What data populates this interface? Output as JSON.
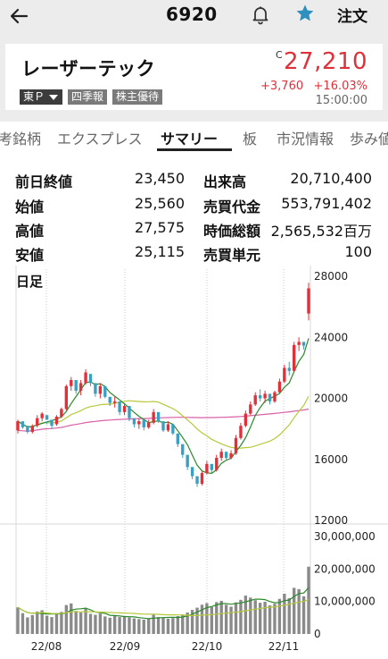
{
  "header": {
    "code": "6920",
    "order_label": "注文"
  },
  "quote": {
    "name": "レーザーテック",
    "c_mark": "C",
    "price": "27,210",
    "change": "+3,760",
    "change_pct": "+16.03%",
    "time": "15:00:00",
    "tags": [
      "東Ｐ",
      "四季報",
      "株主優待"
    ]
  },
  "tabs": [
    "考銘柄",
    "エクスプレス",
    "サマリー",
    "板",
    "市況情報",
    "歩み値"
  ],
  "active_tab": "サマリー",
  "stats": [
    {
      "label": "前日終値",
      "value": "23,450"
    },
    {
      "label": "始値",
      "value": "25,560"
    },
    {
      "label": "高値",
      "value": "27,575"
    },
    {
      "label": "安値",
      "value": "25,115"
    },
    {
      "label": "出来高",
      "value": "20,710,400"
    },
    {
      "label": "売買代金",
      "value": "553,791,402"
    },
    {
      "label": "時価総額",
      "value": "2,565,532百万"
    },
    {
      "label": "売買単元",
      "value": "100"
    }
  ],
  "chart_data": {
    "type": "candlestick",
    "title": "日足",
    "price_ticks": [
      "28000",
      "24000",
      "20000",
      "16000",
      "12000"
    ],
    "volume_ticks": [
      "30,000,000",
      "20,000,000",
      "10,000,000",
      "0"
    ],
    "x_ticks": [
      "22/08",
      "22/09",
      "22/10",
      "22/11"
    ],
    "ylim": [
      12000,
      28000
    ],
    "volume_ylim": [
      0,
      30000000
    ],
    "colors": {
      "up": "#e0303a",
      "down": "#3a9fc0",
      "ma_short": "#2a8a2a",
      "ma_mid": "#b7c93a",
      "ma_long": "#d860a8",
      "volume": "#8a8a8a"
    },
    "candles": [
      [
        17900,
        18600,
        17700,
        18500
      ],
      [
        18500,
        18400,
        18000,
        18100
      ],
      [
        18200,
        18000,
        17700,
        17800
      ],
      [
        17800,
        18300,
        17700,
        18200
      ],
      [
        18200,
        18900,
        18100,
        18700
      ],
      [
        18700,
        19100,
        18500,
        19000
      ],
      [
        18900,
        18500,
        18300,
        18600
      ],
      [
        18600,
        18400,
        18000,
        18200
      ],
      [
        18300,
        18900,
        18200,
        18800
      ],
      [
        18800,
        19400,
        18700,
        19300
      ],
      [
        19300,
        20900,
        19200,
        20800
      ],
      [
        20800,
        21400,
        20500,
        21200
      ],
      [
        21200,
        20700,
        20300,
        20500
      ],
      [
        20500,
        21200,
        20200,
        21000
      ],
      [
        21000,
        21900,
        20900,
        21700
      ],
      [
        21600,
        21300,
        20800,
        21000
      ],
      [
        21000,
        20600,
        20100,
        20300
      ],
      [
        20300,
        21000,
        20000,
        20800
      ],
      [
        20800,
        20400,
        20000,
        20100
      ],
      [
        20100,
        19900,
        19500,
        19700
      ],
      [
        19700,
        20100,
        19400,
        19800
      ],
      [
        19800,
        19300,
        18900,
        19100
      ],
      [
        19100,
        19700,
        18900,
        19500
      ],
      [
        19500,
        19000,
        18500,
        18700
      ],
      [
        18700,
        18400,
        18100,
        18300
      ],
      [
        18300,
        18700,
        18000,
        18500
      ],
      [
        18600,
        18300,
        17900,
        18100
      ],
      [
        18100,
        18600,
        18000,
        18400
      ],
      [
        18400,
        19300,
        18300,
        19100
      ],
      [
        19100,
        18700,
        18400,
        18500
      ],
      [
        18500,
        18100,
        17800,
        17900
      ],
      [
        17900,
        18500,
        17800,
        18300
      ],
      [
        18300,
        17900,
        17600,
        17700
      ],
      [
        17700,
        17300,
        16800,
        17000
      ],
      [
        17000,
        16500,
        16100,
        16300
      ],
      [
        16300,
        15900,
        15300,
        15500
      ],
      [
        15500,
        15200,
        14700,
        14900
      ],
      [
        14900,
        14700,
        14200,
        14400
      ],
      [
        14400,
        15200,
        14300,
        15100
      ],
      [
        15100,
        15900,
        15000,
        15700
      ],
      [
        15700,
        15500,
        15100,
        15300
      ],
      [
        15300,
        16300,
        15200,
        16100
      ],
      [
        16100,
        16700,
        15900,
        16500
      ],
      [
        16500,
        16300,
        15900,
        16100
      ],
      [
        16100,
        16600,
        16000,
        16400
      ],
      [
        16400,
        17600,
        16300,
        17400
      ],
      [
        17400,
        18400,
        17300,
        18200
      ],
      [
        18200,
        19200,
        18100,
        19000
      ],
      [
        19000,
        19800,
        18900,
        19600
      ],
      [
        19600,
        20400,
        19500,
        20200
      ],
      [
        20200,
        20600,
        19800,
        20000
      ],
      [
        20000,
        20500,
        19700,
        20300
      ],
      [
        20300,
        20000,
        19600,
        19800
      ],
      [
        19800,
        20500,
        19700,
        20400
      ],
      [
        20400,
        21300,
        20300,
        21100
      ],
      [
        21100,
        22200,
        21000,
        22000
      ],
      [
        22000,
        22400,
        21500,
        21800
      ],
      [
        21800,
        23700,
        21700,
        23500
      ],
      [
        23500,
        24000,
        23100,
        23700
      ],
      [
        23700,
        23500,
        23200,
        23450
      ],
      [
        25560,
        27575,
        25115,
        27210
      ]
    ],
    "volumes": [
      8200000,
      6400000,
      5100000,
      5800000,
      6900000,
      7300000,
      5600000,
      5200000,
      6100000,
      6800000,
      8900000,
      9400000,
      7100000,
      6600000,
      7800000,
      6200000,
      5900000,
      6300000,
      5400000,
      5000000,
      5700000,
      5200000,
      5500000,
      5100000,
      4800000,
      4600000,
      4400000,
      4700000,
      5900000,
      5200000,
      5000000,
      4700000,
      4900000,
      5500000,
      6000000,
      6600000,
      7400000,
      8100000,
      9000000,
      9500000,
      8300000,
      9800000,
      10200000,
      9000000,
      8400000,
      9700000,
      10500000,
      11800000,
      11200000,
      10400000,
      9600000,
      9900000,
      8800000,
      9300000,
      10800000,
      12400000,
      11000000,
      14200000,
      13800000,
      11600000,
      20710400
    ]
  }
}
